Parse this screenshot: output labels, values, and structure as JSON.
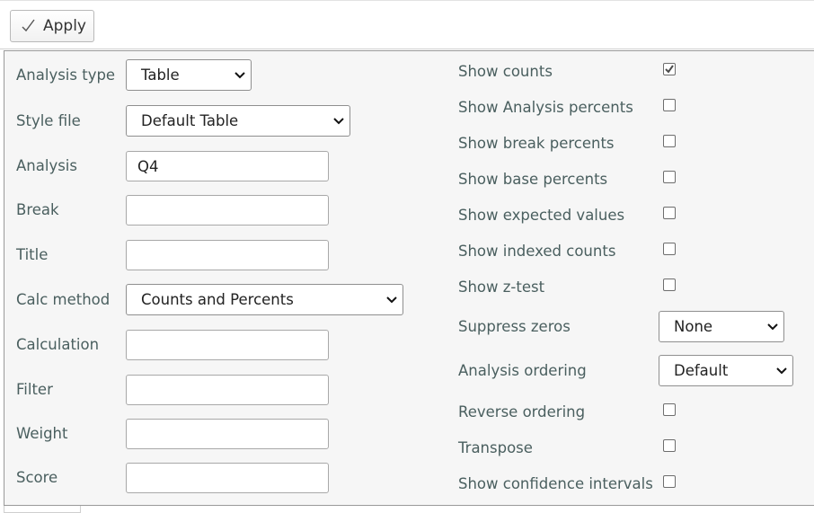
{
  "toolbar": {
    "apply_label": "Apply",
    "apply_icon": "check-icon"
  },
  "left": {
    "analysis_type": {
      "label": "Analysis type",
      "value": "Table"
    },
    "style_file": {
      "label": "Style file",
      "value": "Default Table"
    },
    "analysis": {
      "label": "Analysis",
      "value": "Q4"
    },
    "break": {
      "label": "Break",
      "value": ""
    },
    "title": {
      "label": "Title",
      "value": ""
    },
    "calc_method": {
      "label": "Calc method",
      "value": "Counts and Percents"
    },
    "calculation": {
      "label": "Calculation",
      "value": ""
    },
    "filter": {
      "label": "Filter",
      "value": ""
    },
    "weight": {
      "label": "Weight",
      "value": ""
    },
    "score": {
      "label": "Score",
      "value": ""
    }
  },
  "right": {
    "show_counts": {
      "label": "Show counts",
      "checked": true
    },
    "show_analysis_percents": {
      "label": "Show Analysis percents",
      "checked": false
    },
    "show_break_percents": {
      "label": "Show break percents",
      "checked": false
    },
    "show_base_percents": {
      "label": "Show base percents",
      "checked": false
    },
    "show_expected_values": {
      "label": "Show expected values",
      "checked": false
    },
    "show_indexed_counts": {
      "label": "Show indexed counts",
      "checked": false
    },
    "show_z_test": {
      "label": "Show z-test",
      "checked": false
    },
    "suppress_zeros": {
      "label": "Suppress zeros",
      "value": "None"
    },
    "analysis_ordering": {
      "label": "Analysis ordering",
      "value": "Default"
    },
    "reverse_ordering": {
      "label": "Reverse ordering",
      "checked": false
    },
    "transpose": {
      "label": "Transpose",
      "checked": false
    },
    "show_confidence_intervals": {
      "label": "Show confidence intervals",
      "checked": false
    }
  },
  "colors": {
    "label": "#4a5f5f",
    "panel_bg": "#f6f6f6",
    "border": "#9a9a9a"
  }
}
